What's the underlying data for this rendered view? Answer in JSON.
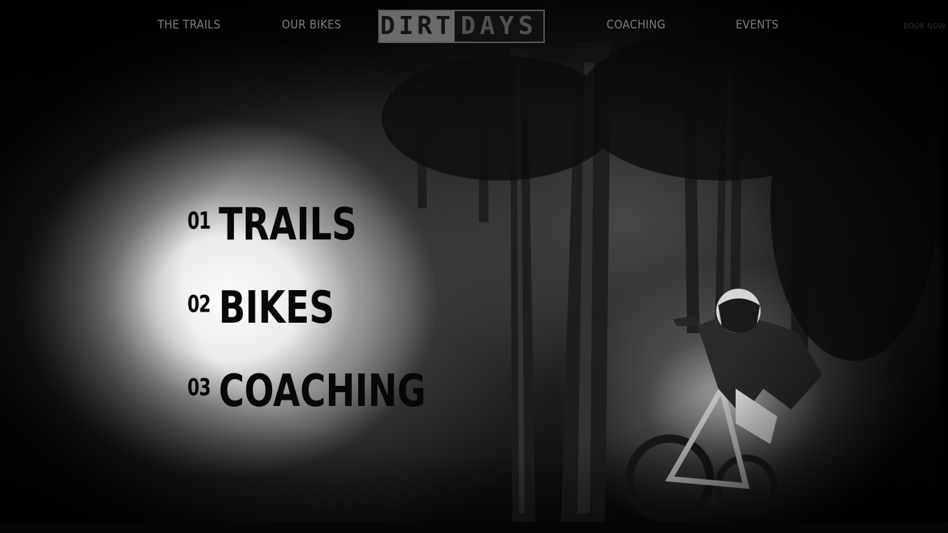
{
  "nav": {
    "links": [
      {
        "label": "THE TRAILS"
      },
      {
        "label": "OUR BIKES"
      },
      {
        "label": "COACHING"
      },
      {
        "label": "EVENTS"
      }
    ],
    "booking_label": "BOOK NOW",
    "logo": {
      "word_1": "DIRT",
      "word_2": "DAYS"
    }
  },
  "menu": {
    "items": [
      {
        "number": "01",
        "label": "TRAILS"
      },
      {
        "number": "02",
        "label": "BIKES"
      },
      {
        "number": "03",
        "label": "COACHING"
      }
    ]
  },
  "colors": {
    "background": "#000000",
    "nav_text": "#7c7c7c",
    "menu_text": "#070707"
  }
}
